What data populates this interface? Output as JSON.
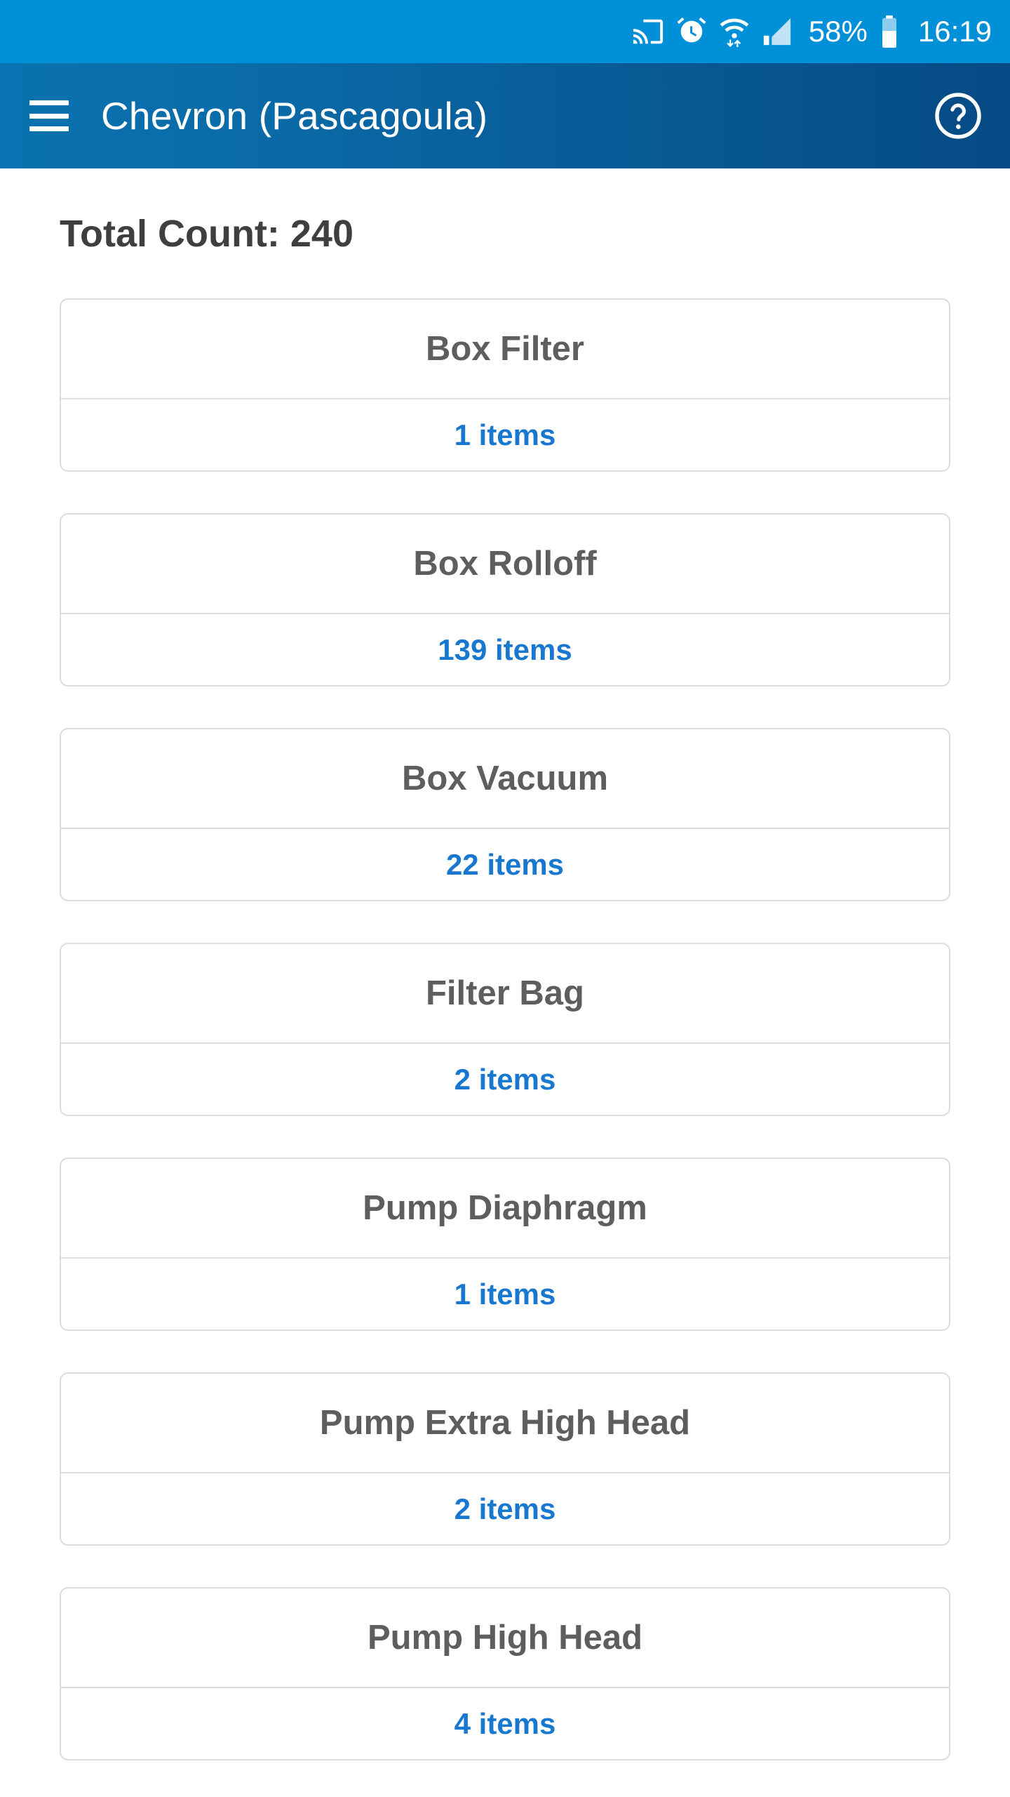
{
  "status_bar": {
    "background_color": "#0090d7",
    "icons": [
      "cast-icon",
      "alarm-clock-icon",
      "wifi-icon",
      "cellular-signal-icon",
      "battery-icon"
    ],
    "battery_percent": "58%",
    "clock": "16:19"
  },
  "app_bar": {
    "menu_icon": "hamburger-menu-icon",
    "title": "Chevron (Pascagoula)",
    "help_icon": "help-circle-icon",
    "gradient_start_color": "#0a72b0",
    "gradient_end_color": "#064a85"
  },
  "main": {
    "total_count_label": "Total Count: 240",
    "count_text_color": "#1878cf",
    "title_text_color": "#5e5e5e",
    "cards": [
      {
        "title": "Box Filter",
        "count": "1 items"
      },
      {
        "title": "Box Rolloff",
        "count": "139 items"
      },
      {
        "title": "Box Vacuum",
        "count": "22 items"
      },
      {
        "title": "Filter Bag",
        "count": "2 items"
      },
      {
        "title": "Pump Diaphragm",
        "count": "1 items"
      },
      {
        "title": "Pump Extra High Head",
        "count": "2 items"
      },
      {
        "title": "Pump High Head",
        "count": "4 items"
      }
    ]
  }
}
